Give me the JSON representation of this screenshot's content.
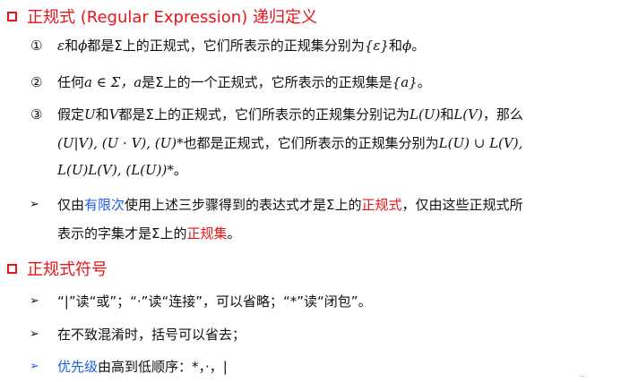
{
  "section1": {
    "title": "正规式 (Regular Expression) 递归定义",
    "item1": {
      "marker": "①",
      "eps": "ε",
      "and1": "和",
      "phi": "ϕ",
      "rest1": "都是Σ上的正规式，它们所表示的正规集分别为",
      "set_eps": "{ε}",
      "and2": "和",
      "phi2": "ϕ",
      "end": "。"
    },
    "item2": {
      "marker": "②",
      "t1": "任何",
      "a_in_sigma": "a ∈ Σ，",
      "a": "a",
      "t2": "是Σ上的一个正规式，它所表示的正规集是",
      "set_a": "{a}",
      "end": "。"
    },
    "item3": {
      "marker": "③",
      "l1_t1": "假定",
      "U": "U",
      "l1_and": "和",
      "V": "V",
      "l1_t2": "都是Σ上的正规式，它们所表示的正规集分别记为",
      "LU": "L(U)",
      "l1_and2": "和",
      "LV": "L(V)",
      "l1_t3": "，那么",
      "l2_exprs": "(U|V), (U · V), (U)*",
      "l2_t1": "也都是正规式，它们所表示的正规集分别为",
      "l2_union": "L(U) ∪ L(V),",
      "l3_exprs": "L(U)L(V), (L(U))*",
      "l3_end": "。"
    },
    "note": {
      "l1_t1": "仅由",
      "l1_finite": "有限次",
      "l1_t2": "使用上述三步骤得到的表达式才是Σ上的",
      "l1_regex": "正规式",
      "l1_t3": "，仅由这些正规式所",
      "l2_t1": "表示的字集才是Σ上的",
      "l2_regset": "正规集",
      "l2_end": "。"
    }
  },
  "section2": {
    "title": "正规式符号",
    "b1": "“|”读“或”；“·”读“连接”，可以省略；“*”读“闭包”。",
    "b2": "在不致混淆时，括号可以省去；",
    "b3_blue": "优先级",
    "b3_rest": "由高到低顺序：*，·，|"
  },
  "arrow_glyph": "➢",
  "corner_mark": "~"
}
